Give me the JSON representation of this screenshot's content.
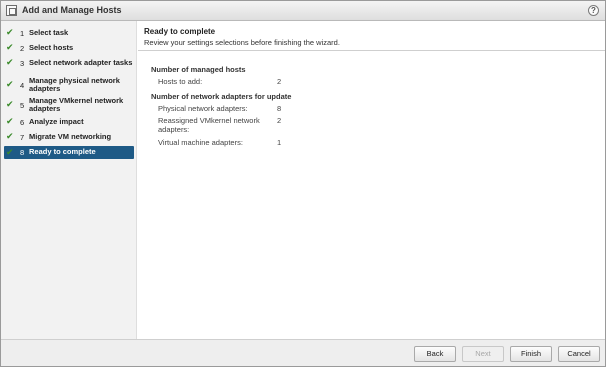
{
  "window": {
    "title": "Add and Manage Hosts",
    "help_label": "?"
  },
  "steps": [
    {
      "num": "1",
      "label": "Select task"
    },
    {
      "num": "2",
      "label": "Select hosts"
    },
    {
      "num": "3",
      "label": "Select network adapter tasks"
    },
    {
      "num": "4",
      "label": "Manage physical network adapters"
    },
    {
      "num": "5",
      "label": "Manage VMkernel network adapters"
    },
    {
      "num": "6",
      "label": "Analyze impact"
    },
    {
      "num": "7",
      "label": "Migrate VM networking"
    },
    {
      "num": "8",
      "label": "Ready to complete"
    }
  ],
  "check_glyph": "✔",
  "main": {
    "heading": "Ready to complete",
    "subheading": "Review your settings selections before finishing the wizard.",
    "section1": {
      "title": "Number of managed hosts",
      "rows": [
        {
          "label": "Hosts to add:",
          "value": "2"
        }
      ]
    },
    "section2": {
      "title": "Number of network adapters for update",
      "rows": [
        {
          "label": "Physical network adapters:",
          "value": "8"
        },
        {
          "label": "Reassigned VMkernel network adapters:",
          "value": "2"
        },
        {
          "label": "Virtual machine adapters:",
          "value": "1"
        }
      ]
    }
  },
  "footer": {
    "back": "Back",
    "next": "Next",
    "finish": "Finish",
    "cancel": "Cancel"
  },
  "colors": {
    "active_step": "#1e5a86",
    "check": "#3a8a2a",
    "sidebar_bg": "#f2f2f2"
  }
}
